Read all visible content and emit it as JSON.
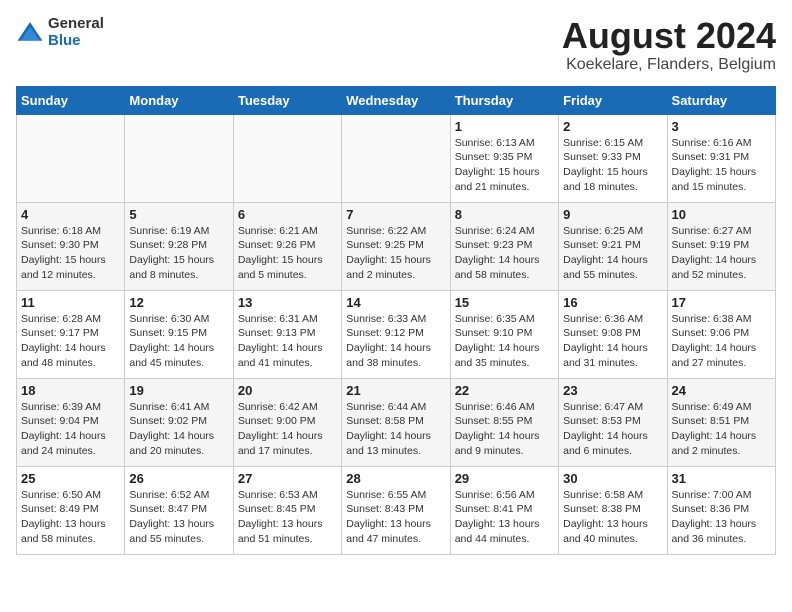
{
  "logo": {
    "general": "General",
    "blue": "Blue"
  },
  "title": "August 2024",
  "subtitle": "Koekelare, Flanders, Belgium",
  "days_of_week": [
    "Sunday",
    "Monday",
    "Tuesday",
    "Wednesday",
    "Thursday",
    "Friday",
    "Saturday"
  ],
  "weeks": [
    [
      {
        "day": "",
        "info": ""
      },
      {
        "day": "",
        "info": ""
      },
      {
        "day": "",
        "info": ""
      },
      {
        "day": "",
        "info": ""
      },
      {
        "day": "1",
        "info": "Sunrise: 6:13 AM\nSunset: 9:35 PM\nDaylight: 15 hours\nand 21 minutes."
      },
      {
        "day": "2",
        "info": "Sunrise: 6:15 AM\nSunset: 9:33 PM\nDaylight: 15 hours\nand 18 minutes."
      },
      {
        "day": "3",
        "info": "Sunrise: 6:16 AM\nSunset: 9:31 PM\nDaylight: 15 hours\nand 15 minutes."
      }
    ],
    [
      {
        "day": "4",
        "info": "Sunrise: 6:18 AM\nSunset: 9:30 PM\nDaylight: 15 hours\nand 12 minutes."
      },
      {
        "day": "5",
        "info": "Sunrise: 6:19 AM\nSunset: 9:28 PM\nDaylight: 15 hours\nand 8 minutes."
      },
      {
        "day": "6",
        "info": "Sunrise: 6:21 AM\nSunset: 9:26 PM\nDaylight: 15 hours\nand 5 minutes."
      },
      {
        "day": "7",
        "info": "Sunrise: 6:22 AM\nSunset: 9:25 PM\nDaylight: 15 hours\nand 2 minutes."
      },
      {
        "day": "8",
        "info": "Sunrise: 6:24 AM\nSunset: 9:23 PM\nDaylight: 14 hours\nand 58 minutes."
      },
      {
        "day": "9",
        "info": "Sunrise: 6:25 AM\nSunset: 9:21 PM\nDaylight: 14 hours\nand 55 minutes."
      },
      {
        "day": "10",
        "info": "Sunrise: 6:27 AM\nSunset: 9:19 PM\nDaylight: 14 hours\nand 52 minutes."
      }
    ],
    [
      {
        "day": "11",
        "info": "Sunrise: 6:28 AM\nSunset: 9:17 PM\nDaylight: 14 hours\nand 48 minutes."
      },
      {
        "day": "12",
        "info": "Sunrise: 6:30 AM\nSunset: 9:15 PM\nDaylight: 14 hours\nand 45 minutes."
      },
      {
        "day": "13",
        "info": "Sunrise: 6:31 AM\nSunset: 9:13 PM\nDaylight: 14 hours\nand 41 minutes."
      },
      {
        "day": "14",
        "info": "Sunrise: 6:33 AM\nSunset: 9:12 PM\nDaylight: 14 hours\nand 38 minutes."
      },
      {
        "day": "15",
        "info": "Sunrise: 6:35 AM\nSunset: 9:10 PM\nDaylight: 14 hours\nand 35 minutes."
      },
      {
        "day": "16",
        "info": "Sunrise: 6:36 AM\nSunset: 9:08 PM\nDaylight: 14 hours\nand 31 minutes."
      },
      {
        "day": "17",
        "info": "Sunrise: 6:38 AM\nSunset: 9:06 PM\nDaylight: 14 hours\nand 27 minutes."
      }
    ],
    [
      {
        "day": "18",
        "info": "Sunrise: 6:39 AM\nSunset: 9:04 PM\nDaylight: 14 hours\nand 24 minutes."
      },
      {
        "day": "19",
        "info": "Sunrise: 6:41 AM\nSunset: 9:02 PM\nDaylight: 14 hours\nand 20 minutes."
      },
      {
        "day": "20",
        "info": "Sunrise: 6:42 AM\nSunset: 9:00 PM\nDaylight: 14 hours\nand 17 minutes."
      },
      {
        "day": "21",
        "info": "Sunrise: 6:44 AM\nSunset: 8:58 PM\nDaylight: 14 hours\nand 13 minutes."
      },
      {
        "day": "22",
        "info": "Sunrise: 6:46 AM\nSunset: 8:55 PM\nDaylight: 14 hours\nand 9 minutes."
      },
      {
        "day": "23",
        "info": "Sunrise: 6:47 AM\nSunset: 8:53 PM\nDaylight: 14 hours\nand 6 minutes."
      },
      {
        "day": "24",
        "info": "Sunrise: 6:49 AM\nSunset: 8:51 PM\nDaylight: 14 hours\nand 2 minutes."
      }
    ],
    [
      {
        "day": "25",
        "info": "Sunrise: 6:50 AM\nSunset: 8:49 PM\nDaylight: 13 hours\nand 58 minutes."
      },
      {
        "day": "26",
        "info": "Sunrise: 6:52 AM\nSunset: 8:47 PM\nDaylight: 13 hours\nand 55 minutes."
      },
      {
        "day": "27",
        "info": "Sunrise: 6:53 AM\nSunset: 8:45 PM\nDaylight: 13 hours\nand 51 minutes."
      },
      {
        "day": "28",
        "info": "Sunrise: 6:55 AM\nSunset: 8:43 PM\nDaylight: 13 hours\nand 47 minutes."
      },
      {
        "day": "29",
        "info": "Sunrise: 6:56 AM\nSunset: 8:41 PM\nDaylight: 13 hours\nand 44 minutes."
      },
      {
        "day": "30",
        "info": "Sunrise: 6:58 AM\nSunset: 8:38 PM\nDaylight: 13 hours\nand 40 minutes."
      },
      {
        "day": "31",
        "info": "Sunrise: 7:00 AM\nSunset: 8:36 PM\nDaylight: 13 hours\nand 36 minutes."
      }
    ]
  ]
}
